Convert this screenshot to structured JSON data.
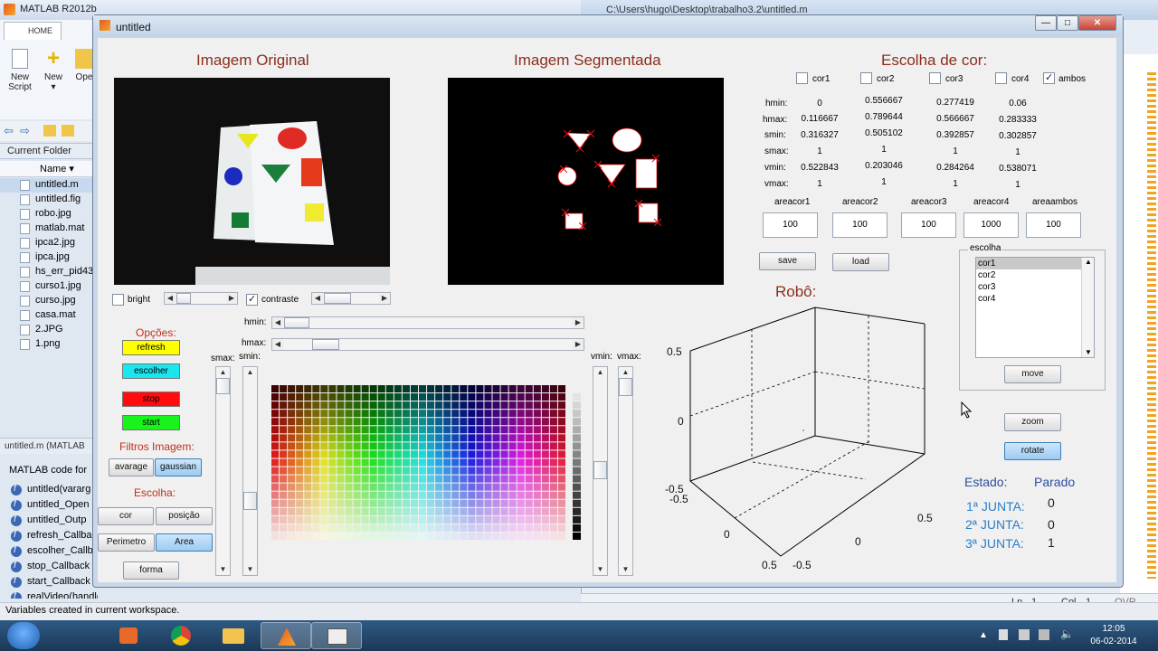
{
  "matlab": {
    "title": "MATLAB R2012b",
    "tab_home": "HOME",
    "buttons": [
      {
        "label1": "New",
        "label2": "Script"
      },
      {
        "label1": "New",
        "label2": "▾"
      },
      {
        "label1": "Ope",
        "label2": ""
      }
    ],
    "current_folder_label": "Current Folder",
    "name_header": "Name ▾",
    "files": [
      "untitled.m",
      "untitled.fig",
      "robo.jpg",
      "matlab.mat",
      "ipca2.jpg",
      "ipca.jpg",
      "hs_err_pid43",
      "curso1.jpg",
      "curso.jpg",
      "casa.mat",
      "2.JPG",
      "1.png"
    ],
    "details_title": "untitled.m (MATLAB",
    "details_text": "MATLAB code for",
    "functions": [
      "untitled(vararg",
      "untitled_Open",
      "untitled_Outp",
      "refresh_Callba",
      "escolher_Callb",
      "stop_Callback",
      "start_Callback",
      "realVideo(handles)"
    ],
    "status": "Variables created in current workspace."
  },
  "editor": {
    "title": "C:\\Users\\hugo\\Desktop\\trabalho3.2\\untitled.m",
    "ln_label": "Ln",
    "ln": "1",
    "col_label": "Col",
    "col": "1",
    "ovr": "OVR"
  },
  "figure": {
    "title": "untitled",
    "win_min": "—",
    "win_max": "□",
    "win_close": "✕",
    "heading_original": "Imagem Original",
    "heading_segmented": "Imagem Segmentada",
    "heading_color": "Escolha de cor:",
    "heading_robot": "Robô:",
    "bright_label": "bright",
    "contraste_label": "contraste",
    "opcoes_label": "Opções:",
    "btn_refresh": "refresh",
    "btn_escolher": "escolher",
    "btn_stop": "stop",
    "btn_start": "start",
    "filtros_label": "Filtros Imagem:",
    "btn_avarage": "avarage",
    "btn_gaussian": "gaussian",
    "escolha_label": "Escolha:",
    "btn_cor": "cor",
    "btn_posicao": "posição",
    "btn_perimetro": "Perimetro",
    "btn_area": "Area",
    "btn_forma": "forma",
    "hmin_label": "hmin:",
    "hmax_label": "hmax:",
    "smax_label": "smax:",
    "smin_label": "smin:",
    "vmin_label": "vmin:",
    "vmax_label": "vmax:",
    "color_checks": [
      {
        "label": "cor1",
        "checked": false
      },
      {
        "label": "cor2",
        "checked": false
      },
      {
        "label": "cor3",
        "checked": false
      },
      {
        "label": "cor4",
        "checked": false
      },
      {
        "label": "ambos",
        "checked": true
      }
    ],
    "param_labels": [
      "hmin:",
      "hmax:",
      "smin:",
      "smax:",
      "vmin:",
      "vmax:"
    ],
    "params": {
      "cor1": [
        "0",
        "0.116667",
        "0.316327",
        "1",
        "0.522843",
        "1"
      ],
      "cor2": [
        "0.556667",
        "0.789644",
        "0.505102",
        "1",
        "0.203046",
        "1"
      ],
      "cor3": [
        "0.277419",
        "0.566667",
        "0.392857",
        "1",
        "0.284264",
        "1"
      ],
      "cor4": [
        "0.06",
        "0.283333",
        "0.302857",
        "1",
        "0.538071",
        "1"
      ]
    },
    "area_labels": [
      "areacor1",
      "areacor2",
      "areacor3",
      "areacor4",
      "areaambos"
    ],
    "area_values": [
      "100",
      "100",
      "100",
      "1000",
      "100"
    ],
    "btn_save": "save",
    "btn_load": "load",
    "escolha_panel_title": "escolha",
    "escolha_items": [
      "cor1",
      "cor2",
      "cor3",
      "cor4"
    ],
    "btn_move": "move",
    "btn_zoom": "zoom",
    "btn_rotate": "rotate",
    "estado_label": "Estado:",
    "estado_value": "Parado",
    "juntas": [
      {
        "label": "1ª JUNTA:",
        "value": "0"
      },
      {
        "label": "2ª JUNTA:",
        "value": "0"
      },
      {
        "label": "3ª JUNTA:",
        "value": "1"
      }
    ],
    "axis_ticks": {
      "z": [
        "0.5",
        "0",
        "-0.5"
      ],
      "x": [
        "-0.5",
        "0",
        "0.5"
      ],
      "y": [
        "-0.5",
        "0",
        "0.5"
      ]
    }
  },
  "taskbar": {
    "time": "12:05",
    "date": "06-02-2014"
  }
}
